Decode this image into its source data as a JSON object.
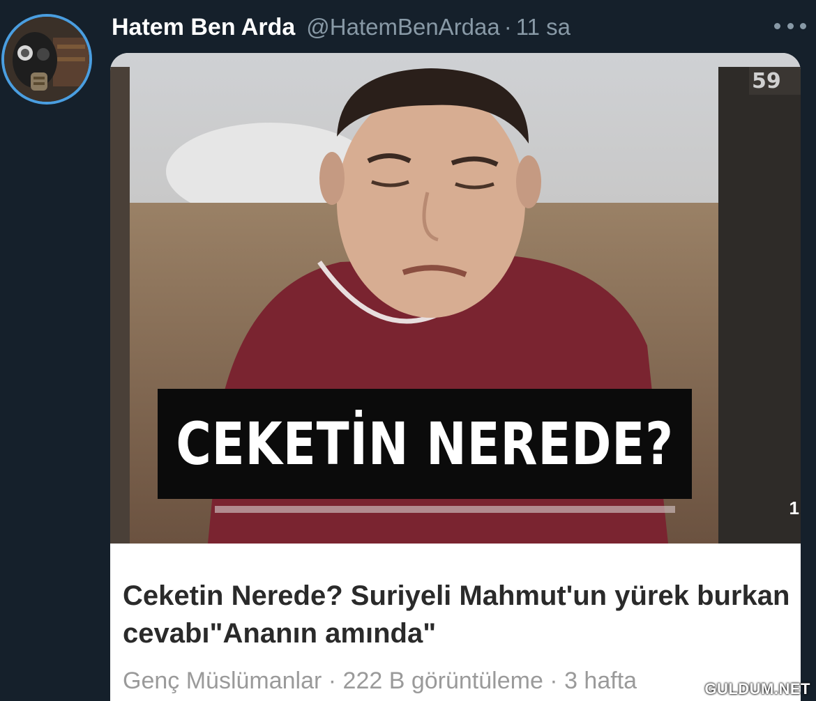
{
  "tweet": {
    "display_name": "Hatem Ben Arda",
    "handle": "@HatemBenArdaa",
    "separator": "·",
    "time": "11 sa",
    "avatar_icon": "gas-mask-avatar",
    "more_icon": "more-horizontal-icon"
  },
  "card": {
    "image_caption": "CEKETİN NEREDE?",
    "side_number": "1",
    "title": "Ceketin Nerede? Suriyeli Mahmut'un yürek burkan cevabı\"Ananın amında\"",
    "meta": "Genç Müslümanlar · 222 B görüntüleme · 3 hafta"
  },
  "watermark": "GULDUM.NET",
  "colors": {
    "background": "#15202b",
    "avatar_ring": "#4a9ee0",
    "secondary_text": "#8899a6"
  }
}
